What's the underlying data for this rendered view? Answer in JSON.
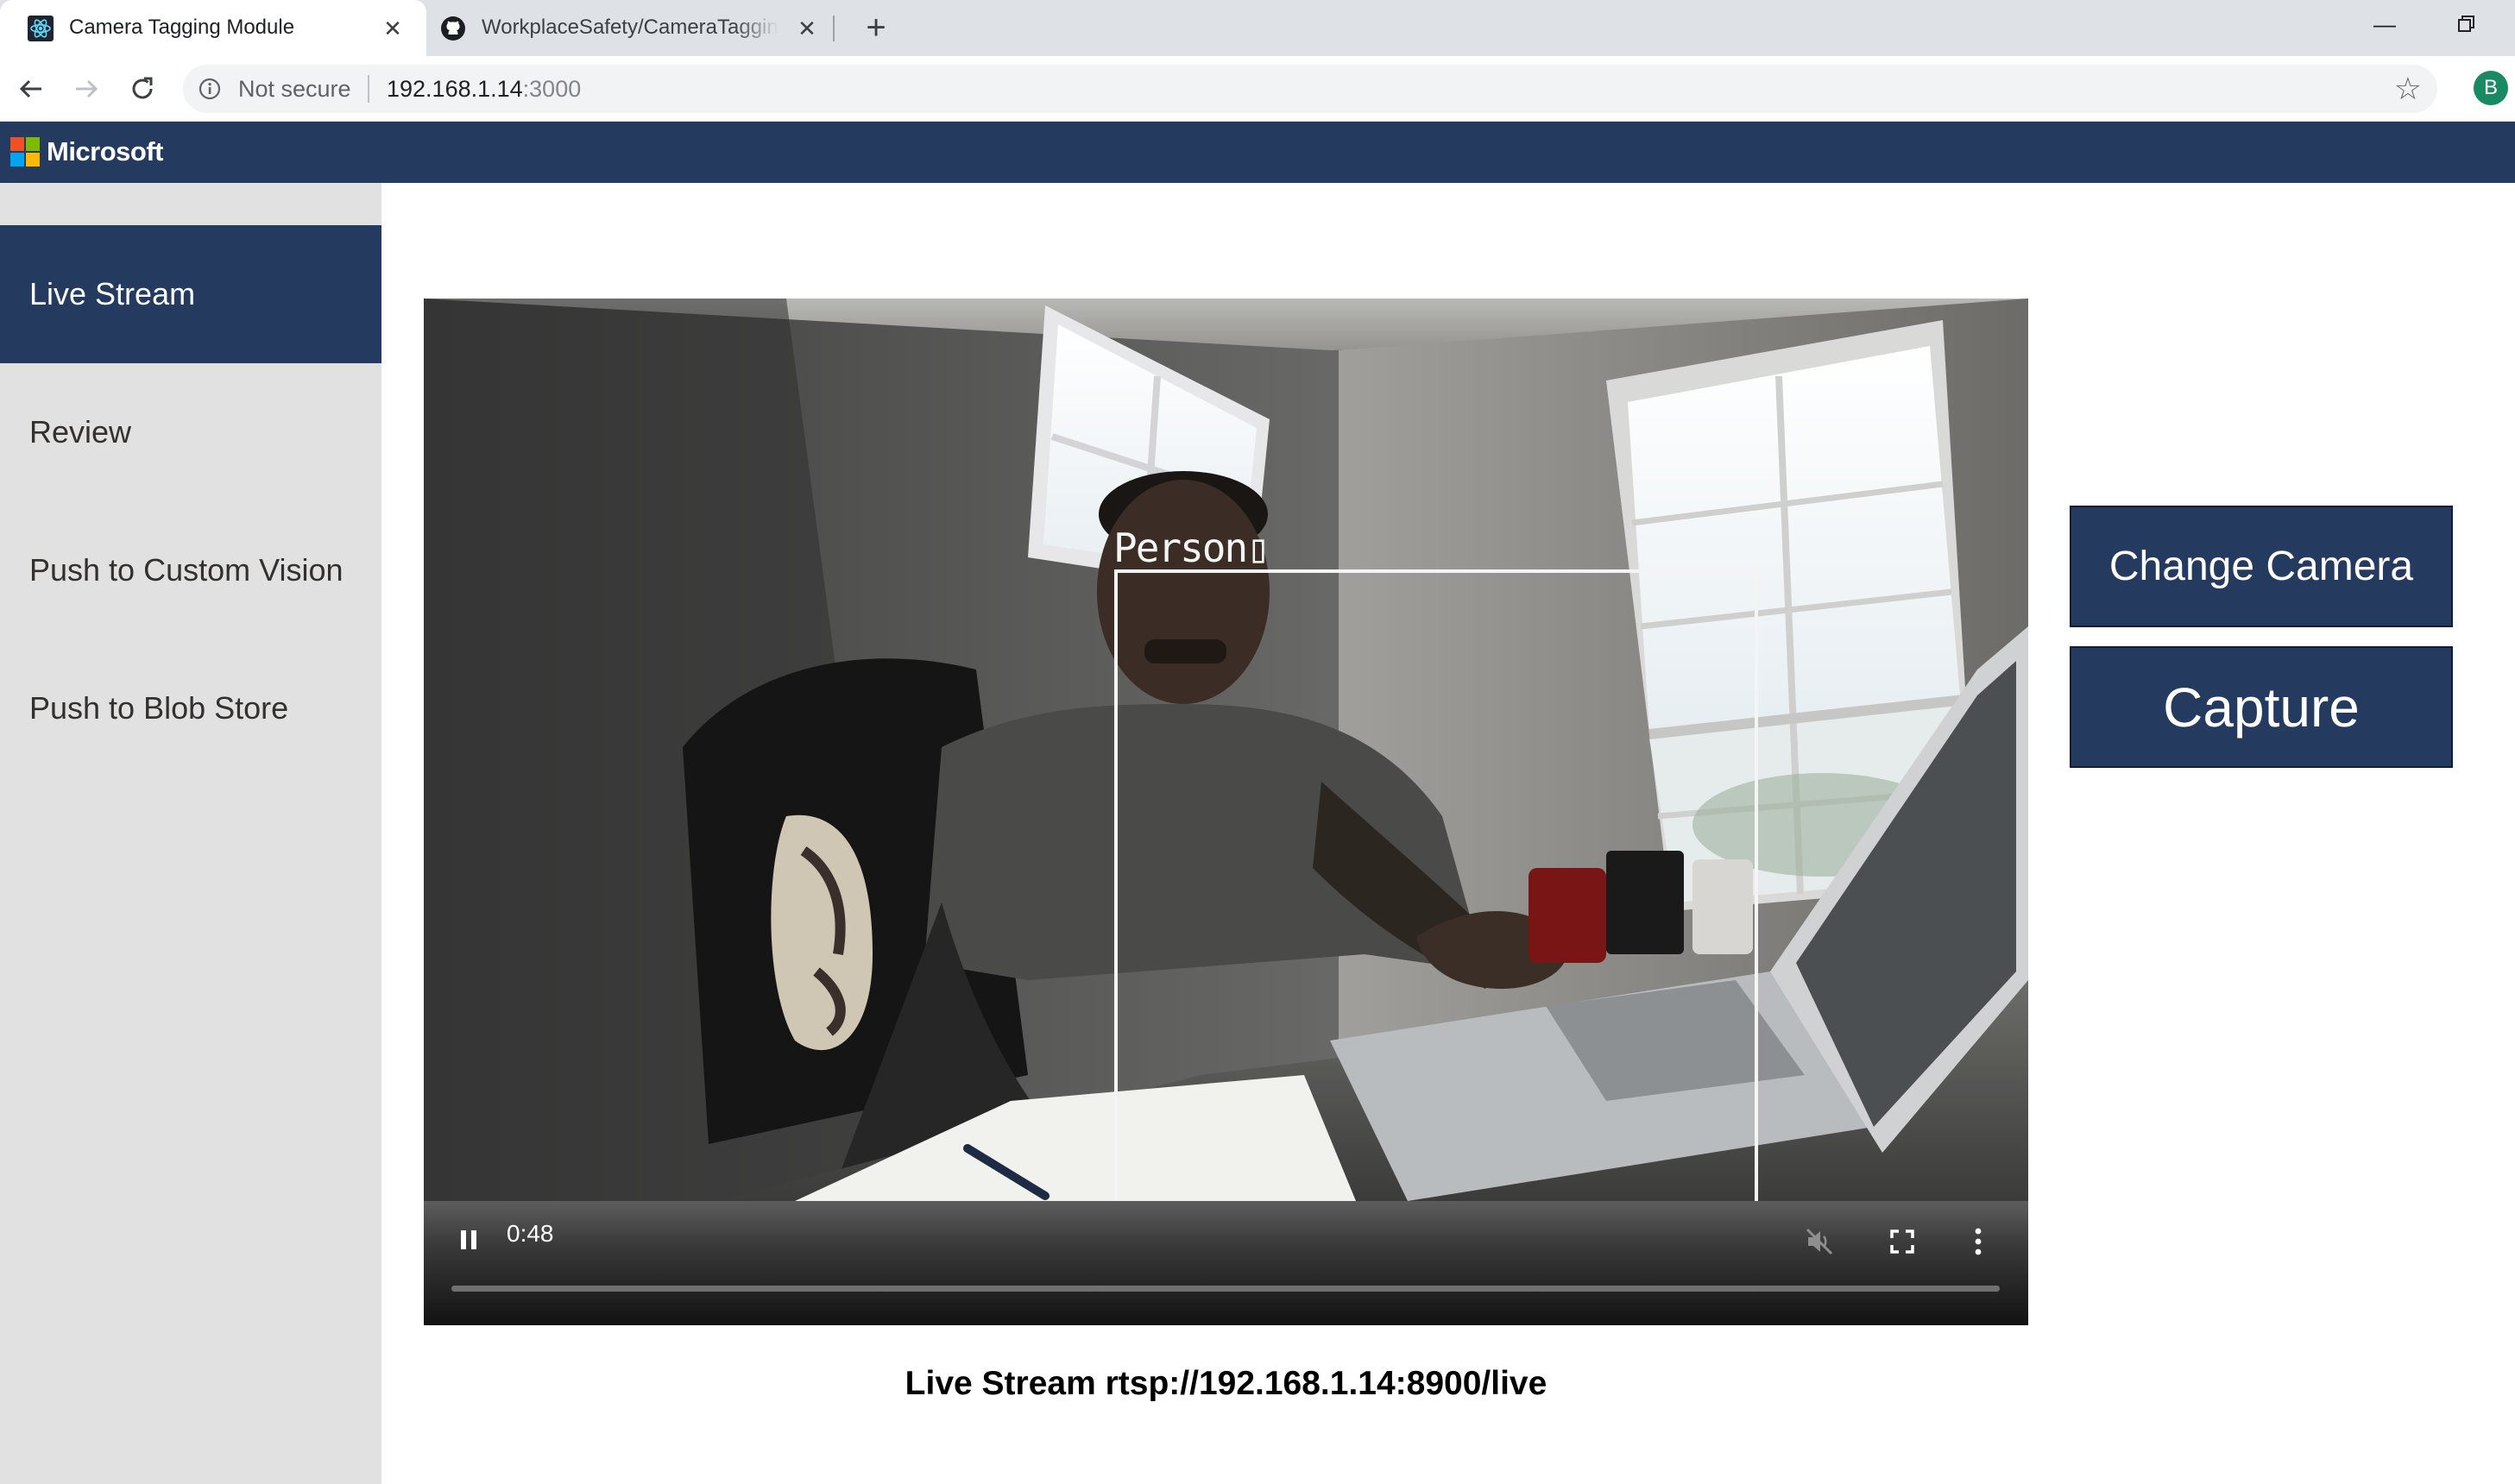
{
  "browser": {
    "tabs": [
      {
        "title": "Camera Tagging Module",
        "active": true,
        "icon": "react-icon"
      },
      {
        "title": "WorkplaceSafety/CameraTagging",
        "active": false,
        "icon": "github-icon"
      }
    ],
    "new_tab_label": "+",
    "address": {
      "security_label": "Not secure",
      "host": "192.168.1.14",
      "port": ":3000"
    },
    "profile_initial": "B"
  },
  "app": {
    "brand": "Microsoft",
    "brand_colors": [
      "#f25022",
      "#7fba00",
      "#00a4ef",
      "#ffb900"
    ],
    "header_color": "#243a5e",
    "sidebar": {
      "items": [
        {
          "label": "Live Stream",
          "active": true
        },
        {
          "label": "Review",
          "active": false
        },
        {
          "label": "Push to Custom Vision",
          "active": false
        },
        {
          "label": "Push to Blob Store",
          "active": false
        }
      ]
    },
    "video": {
      "detection_label": "Person",
      "current_time": "0:48",
      "muted": true,
      "playing": true
    },
    "actions": {
      "change_camera": "Change Camera",
      "capture": "Capture"
    },
    "stream_caption": "Live Stream rtsp://192.168.1.14:8900/live"
  }
}
